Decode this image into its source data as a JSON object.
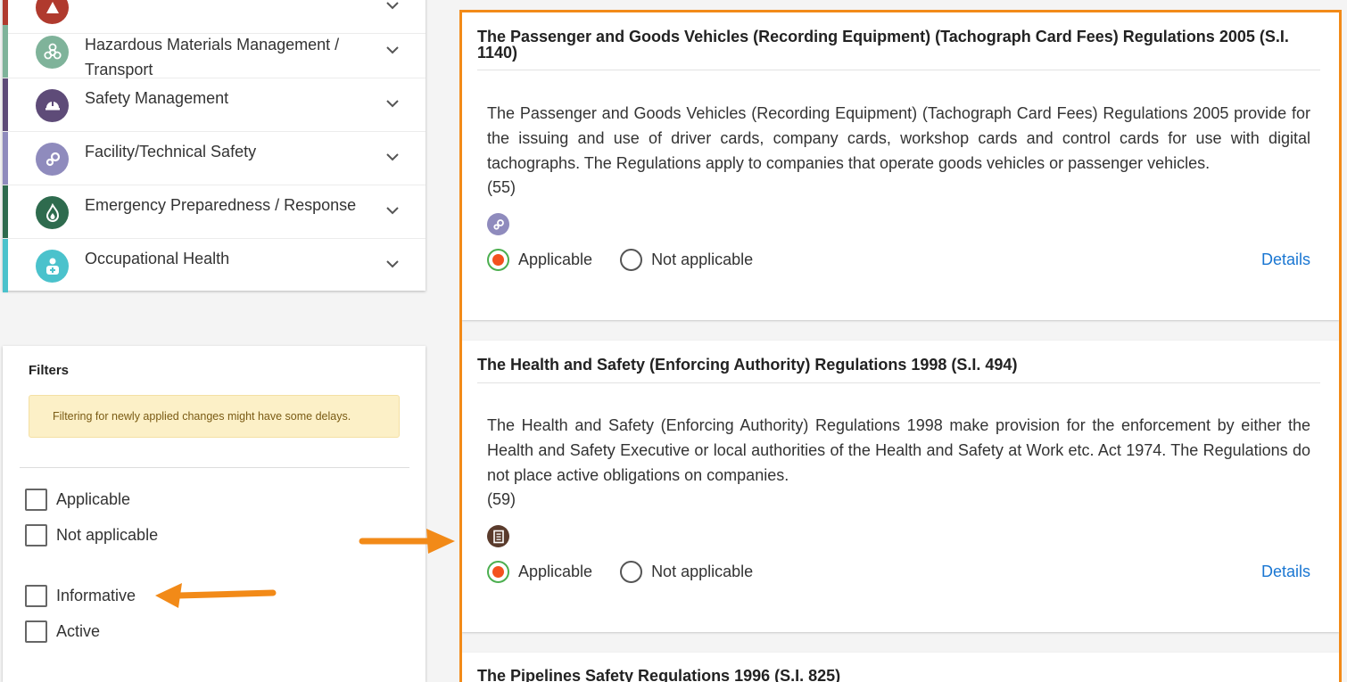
{
  "categories": [
    {
      "label": "",
      "color": "#b03a2e",
      "icon": "warning-icon"
    },
    {
      "label": "Hazardous Materials Management / Transport",
      "color": "#7fb39a",
      "icon": "biohazard-icon"
    },
    {
      "label": "Safety Management",
      "color": "#5e4b78",
      "icon": "hardhat-icon"
    },
    {
      "label": "Facility/Technical Safety",
      "color": "#8f8bbd",
      "icon": "gears-icon"
    },
    {
      "label": "Emergency Preparedness / Response",
      "color": "#2e6b4e",
      "icon": "fire-icon"
    },
    {
      "label": "Occupational Health",
      "color": "#4bc2cc",
      "icon": "health-icon"
    }
  ],
  "filters": {
    "title": "Filters",
    "notice": "Filtering for newly applied changes might have some delays.",
    "options": [
      "Applicable",
      "Not applicable",
      "Informative",
      "Active"
    ]
  },
  "regulations": [
    {
      "title": "The Passenger and Goods Vehicles (Recording Equipment) (Tachograph Card Fees) Regulations 2005 (S.I. 1140)",
      "description": "The Passenger and Goods Vehicles (Recording Equipment) (Tachograph Card Fees) Regulations 2005 provide for the issuing and use of driver cards, company cards, workshop cards and control cards for use with digital tachographs. The Regulations apply to companies that operate goods vehicles or passenger vehicles.",
      "count": "(55)",
      "icon": "gears-icon",
      "applicable_label": "Applicable",
      "not_applicable_label": "Not applicable",
      "selected": "applicable",
      "details_label": "Details"
    },
    {
      "title": "The Health and Safety (Enforcing Authority) Regulations 1998 (S.I. 494)",
      "description": "The Health and Safety (Enforcing Authority) Regulations 1998 make provision for the enforcement by either the Health and Safety Executive or local authorities of the Health and Safety at Work etc. Act 1974. The Regulations do not place active obligations on companies.",
      "count": "(59)",
      "icon": "document-icon",
      "applicable_label": "Applicable",
      "not_applicable_label": "Not applicable",
      "selected": "applicable",
      "details_label": "Details"
    },
    {
      "title": "The Pipelines Safety Regulations 1996 (S.I. 825)"
    }
  ],
  "colors": {
    "highlight": "#f28a18",
    "link": "#1976d2",
    "radio_selected": "#f4511e",
    "notice_bg": "#fcf0c7"
  }
}
